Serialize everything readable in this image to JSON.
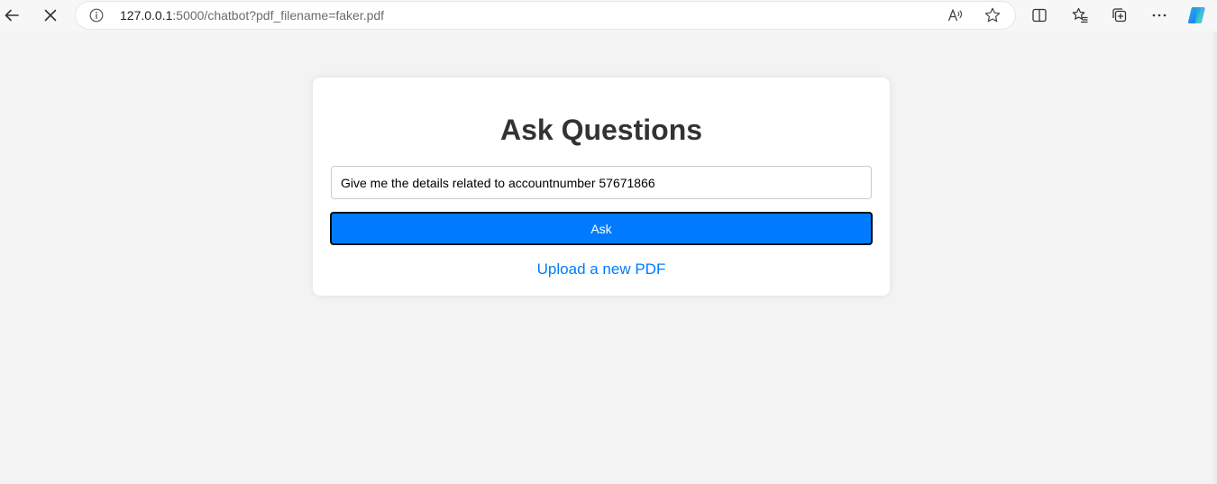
{
  "browser": {
    "url_host": "127.0.0.1",
    "url_rest": ":5000/chatbot?pdf_filename=faker.pdf",
    "icons": {
      "back": "back-arrow-icon",
      "stop": "stop-loading-icon",
      "site_info": "site-info-icon",
      "read_aloud": "read-aloud-icon",
      "favorite": "add-favorite-star-icon",
      "split_screen": "split-screen-icon",
      "favorites": "favorites-icon",
      "collections": "collections-icon",
      "more": "more-options-icon",
      "copilot": "copilot-icon"
    },
    "colors": {
      "toolbar_bg": "#f7f7f7",
      "url_host": "#1f1f1f",
      "url_rest": "#6b6b6b"
    }
  },
  "page": {
    "title": "Ask Questions",
    "question_input": {
      "value": "Give me the details related to accountnumber 57671866",
      "placeholder": ""
    },
    "ask_button_label": "Ask",
    "upload_link_label": "Upload a new PDF",
    "colors": {
      "accent": "#007bff",
      "background": "#f3f3f3",
      "card": "#ffffff",
      "title": "#333333"
    }
  }
}
